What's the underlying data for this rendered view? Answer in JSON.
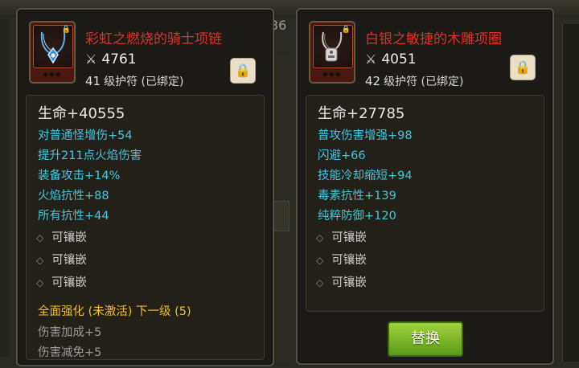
{
  "background": {
    "number_a": "36"
  },
  "left_item": {
    "name": "彩虹之燃烧的骑士项链",
    "power_icon": "crossed-swords-icon",
    "power": "4761",
    "level_num": "41",
    "level_text": "级护符 (已绑定)",
    "hp": "生命+40555",
    "attributes": [
      "对普通怪增伤+54",
      "提升211点火焰伤害",
      "装备攻击+14%",
      "火焰抗性+88",
      "所有抗性+44"
    ],
    "sockets": [
      "可镶嵌",
      "可镶嵌",
      "可镶嵌"
    ],
    "set_header": "全面强化 (未激活) 下一级 (5)",
    "set_lines": [
      "伤害加成+5",
      "伤害减免+5"
    ]
  },
  "right_item": {
    "name": "白银之敏捷的木雕项圈",
    "power_icon": "crossed-swords-icon",
    "power": "4051",
    "level_num": "42",
    "level_text": "级护符 (已绑定)",
    "hp": "生命+27785",
    "attributes": [
      "普攻伤害增强+98",
      "闪避+66",
      "技能冷却缩短+94",
      "毒素抗性+139",
      "纯粹防御+120"
    ],
    "sockets": [
      "可镶嵌",
      "可镶嵌",
      "可镶嵌"
    ],
    "button_label": "替换"
  },
  "colors": {
    "item_name": "#e0322a",
    "attribute": "#45c8dd",
    "set_header": "#f0c020",
    "set_inactive": "#9a9a9a",
    "button": "#7cb82a"
  }
}
